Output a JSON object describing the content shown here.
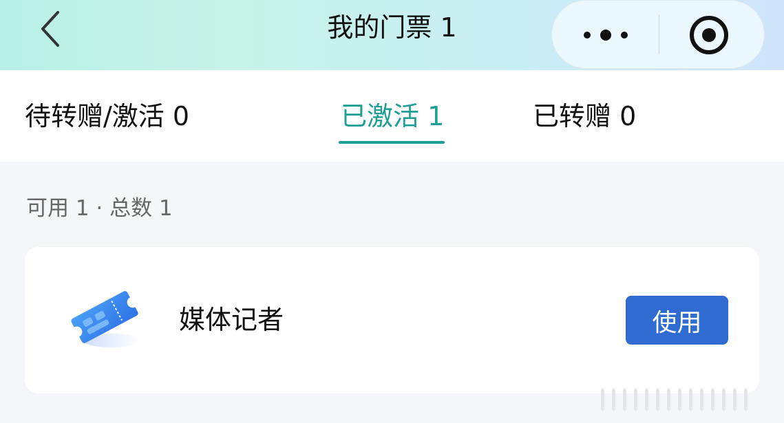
{
  "header": {
    "title": "我的门票 1",
    "back_icon": "chevron-left-icon",
    "more_icon": "more-dots-icon",
    "close_icon": "target-close-icon"
  },
  "tabs": [
    {
      "label": "待转赠/激活 0",
      "active": false
    },
    {
      "label": "已激活 1",
      "active": true
    },
    {
      "label": "已转赠 0",
      "active": false
    }
  ],
  "summary": "可用 1 · 总数 1",
  "tickets": [
    {
      "name": "媒体记者",
      "icon": "ticket-icon",
      "action_label": "使用"
    }
  ],
  "colors": {
    "accent": "#1e9e95",
    "button": "#2f6bd1",
    "header_gradient_start": "#b8f0e6",
    "header_gradient_end": "#cfe4fb",
    "page_background": "#f4f6f9"
  }
}
